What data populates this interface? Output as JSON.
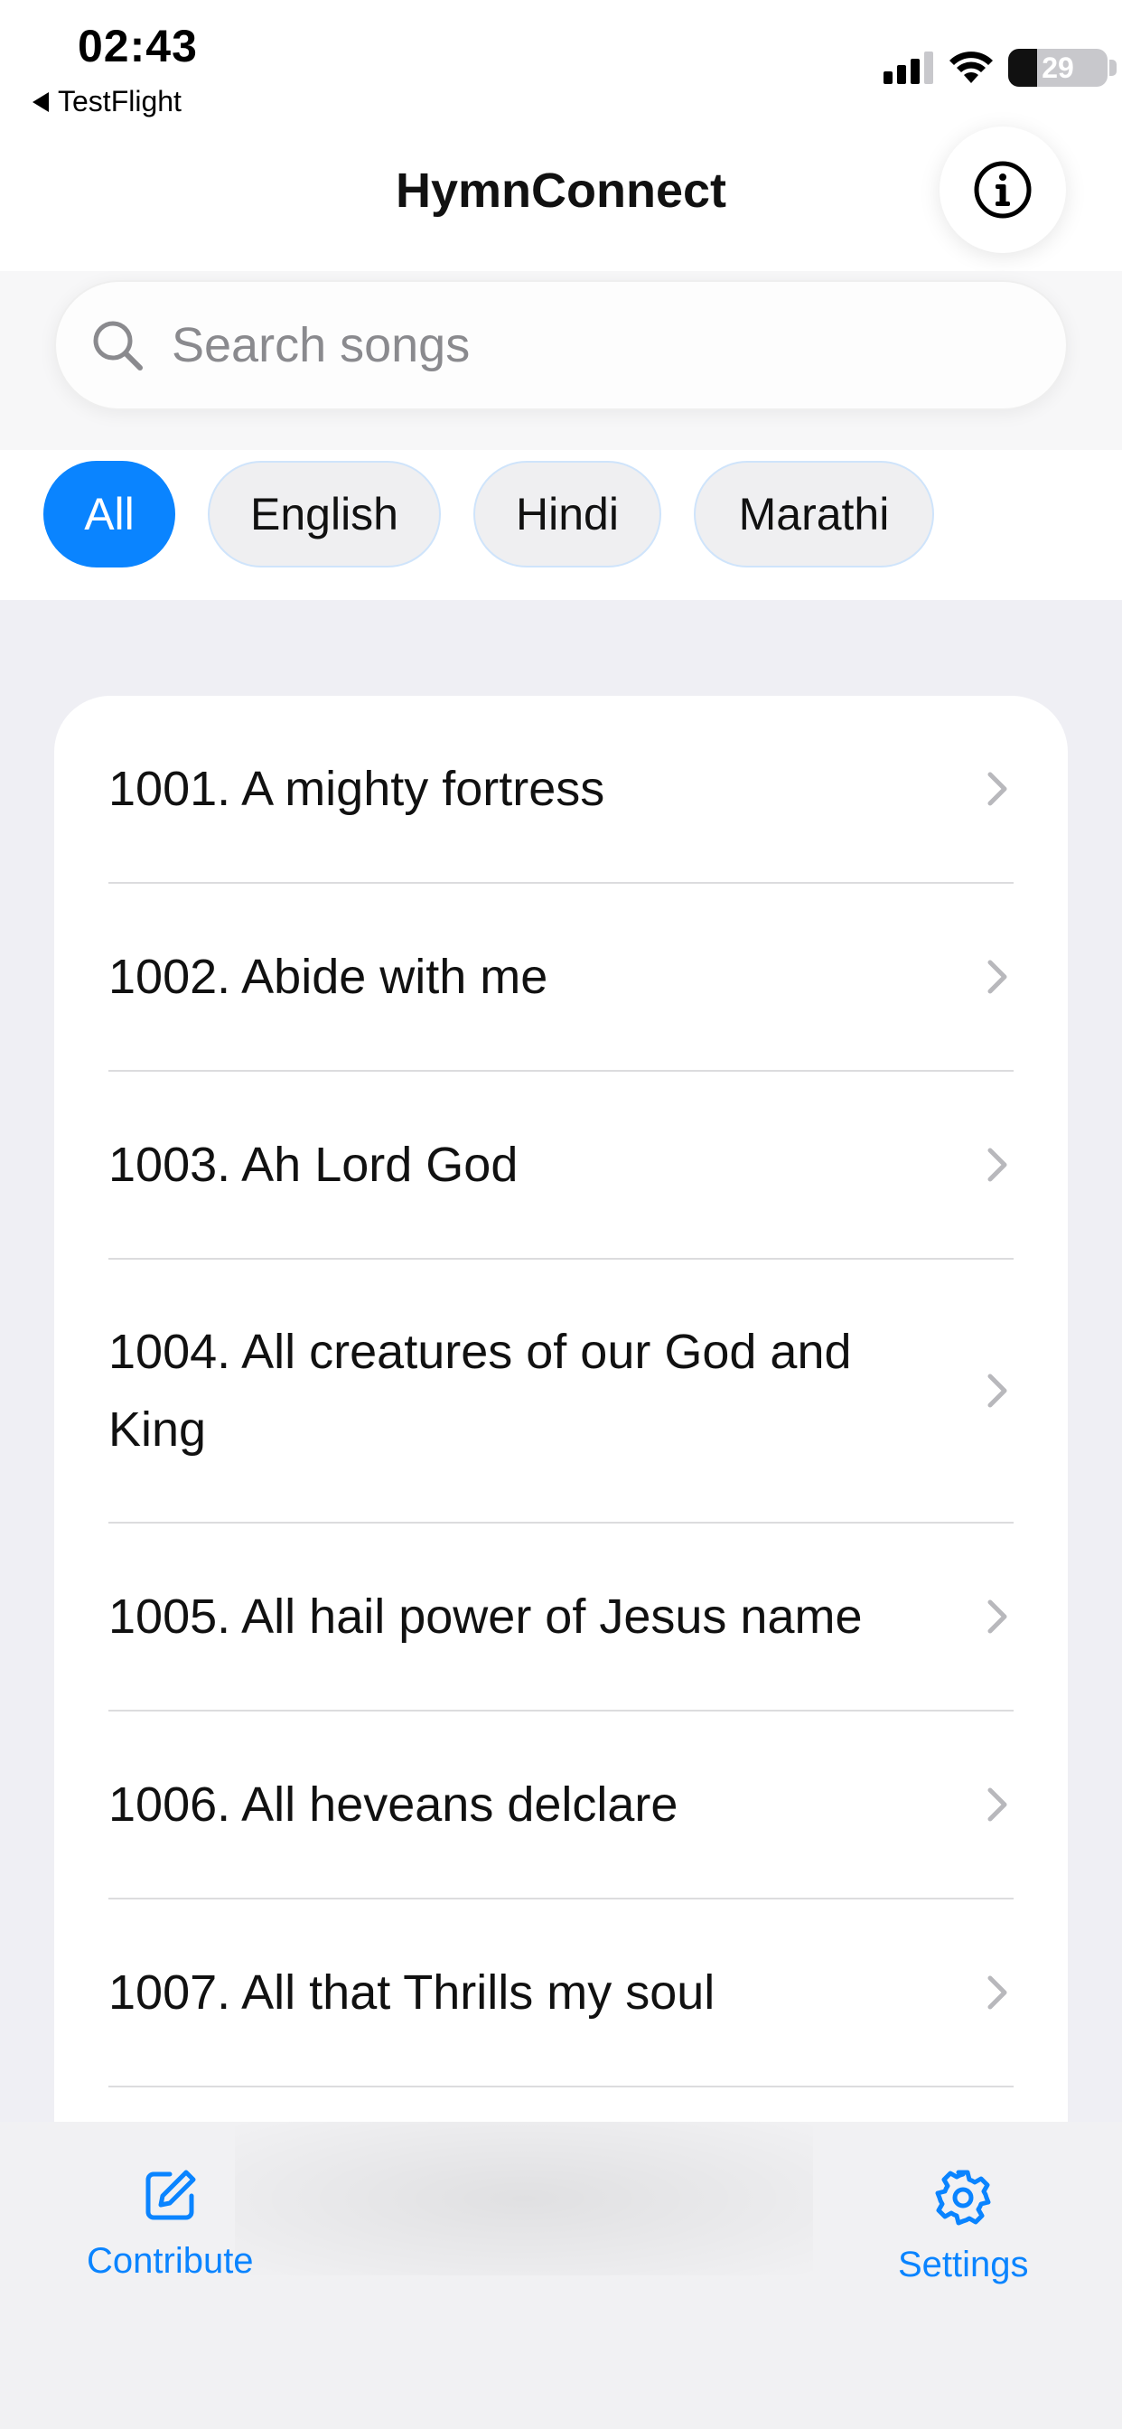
{
  "status_bar": {
    "time": "02:43",
    "back_app": "TestFlight",
    "battery": 29,
    "battery_label": "29"
  },
  "header": {
    "title": "HymnConnect",
    "info_icon": "info-icon"
  },
  "search": {
    "placeholder": "Search songs",
    "value": ""
  },
  "filters": {
    "selected": "All",
    "chips": [
      {
        "label": "All"
      },
      {
        "label": "English"
      },
      {
        "label": "Hindi"
      },
      {
        "label": "Marathi"
      }
    ]
  },
  "songs": [
    {
      "title": "1001. A mighty fortress"
    },
    {
      "title": "1002. Abide with me"
    },
    {
      "title": "1003. Ah Lord God"
    },
    {
      "title": "1004. All creatures of our God and King"
    },
    {
      "title": "1005. All hail power of Jesus name"
    },
    {
      "title": "1006. All heveans delclare"
    },
    {
      "title": "1007. All that Thrills my soul"
    }
  ],
  "tab_bar": {
    "items": [
      {
        "label": "Contribute",
        "icon": "edit-icon"
      },
      {
        "label": "Settings",
        "icon": "gear-icon"
      }
    ]
  },
  "colors": {
    "accent": "#0a84ff",
    "background": "#efeff4",
    "chip_background": "#efeff1",
    "chip_border": "#cfe4fb"
  }
}
